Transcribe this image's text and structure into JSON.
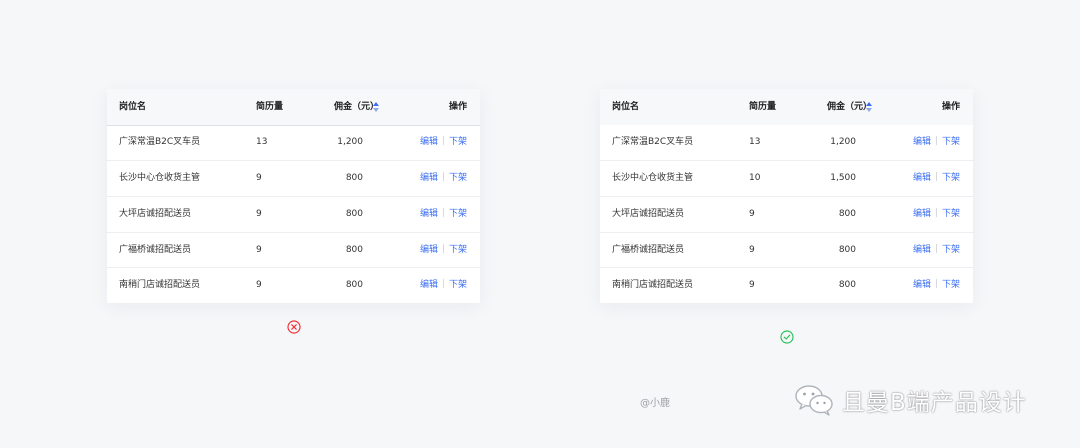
{
  "columns": {
    "name": "岗位名",
    "resumes": "简历量",
    "commission": "佣金（元）",
    "actions": "操作"
  },
  "action_labels": {
    "edit": "编辑",
    "offline": "下架"
  },
  "wrong_example": {
    "rows": [
      {
        "name": "广深常温B2C叉车员",
        "resumes": "13",
        "commission": "1,200"
      },
      {
        "name": "长沙中心仓收货主管",
        "resumes": "9",
        "commission": "800"
      },
      {
        "name": "大坪店诚招配送员",
        "resumes": "9",
        "commission": "800"
      },
      {
        "name": "广福桥诚招配送员",
        "resumes": "9",
        "commission": "800"
      },
      {
        "name": "南稍门店诚招配送员",
        "resumes": "9",
        "commission": "800"
      }
    ],
    "status_icon": "close-circle-icon",
    "status_color": "#f5313a"
  },
  "right_example": {
    "rows": [
      {
        "name": "广深常温B2C叉车员",
        "resumes": "13",
        "commission": "1,200"
      },
      {
        "name": "长沙中心仓收货主管",
        "resumes": "10",
        "commission": "1,500"
      },
      {
        "name": "大坪店诚招配送员",
        "resumes": "9",
        "commission": "800"
      },
      {
        "name": "广福桥诚招配送员",
        "resumes": "9",
        "commission": "800"
      },
      {
        "name": "南稍门店诚招配送员",
        "resumes": "9",
        "commission": "800"
      }
    ],
    "status_icon": "check-circle-icon",
    "status_color": "#2fc25b"
  },
  "sort_icon": "sort-icon",
  "author": "@小鹿",
  "brand": {
    "icon": "wechat-icon",
    "text": "且曼B端产品设计"
  },
  "colors": {
    "link": "#3b6ef5",
    "background": "#f6f7f9"
  }
}
